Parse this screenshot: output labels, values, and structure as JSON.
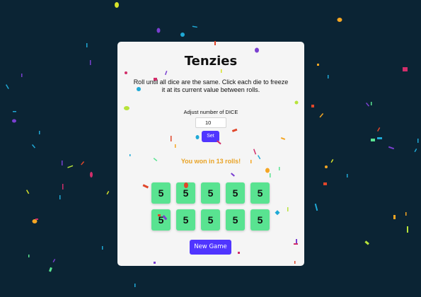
{
  "game": {
    "title": "Tenzies",
    "instructions": "Roll until all dice are the same. Click each die to freeze it at its current value between rolls.",
    "adjust_label": "Adjust number of DICE",
    "dice_count_value": "10",
    "set_button": "Set",
    "win_message": "You won in 13 rolls!",
    "dice": [
      "5",
      "5",
      "5",
      "5",
      "5",
      "5",
      "5",
      "5",
      "5",
      "5"
    ],
    "new_game_button": "New Game"
  },
  "colors": {
    "background": "#0b2434",
    "card": "#f5f5f5",
    "die_held": "#59e391",
    "button": "#5035ff",
    "win_text": "#e9a325"
  }
}
